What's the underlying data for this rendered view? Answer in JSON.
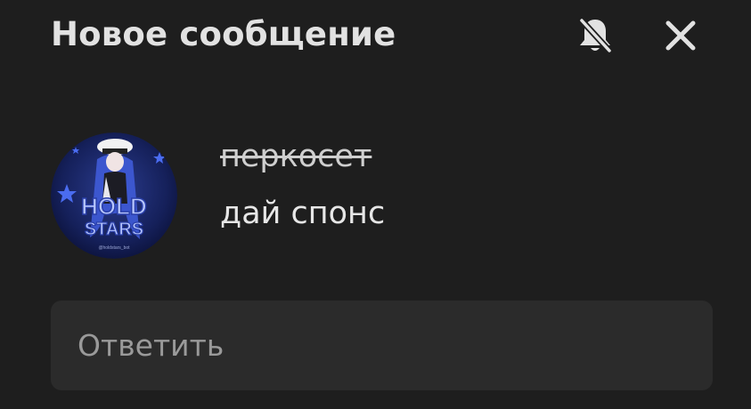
{
  "header": {
    "title": "Новое сообщение"
  },
  "notification": {
    "sender_name": "перкосет",
    "message_text": "дай спонс",
    "avatar": {
      "text_line1": "HOLD",
      "text_line2": "STARS",
      "handle": "@holdstars_bot"
    }
  },
  "reply": {
    "placeholder": "Ответить"
  },
  "icons": {
    "mute": "bell-off-icon",
    "close": "close-icon"
  },
  "colors": {
    "background": "#1e1e1e",
    "input_background": "#2b2b2b",
    "text": "#e6e6e6",
    "placeholder": "#9a9a9a",
    "avatar_blue": "#3f5bd8"
  }
}
